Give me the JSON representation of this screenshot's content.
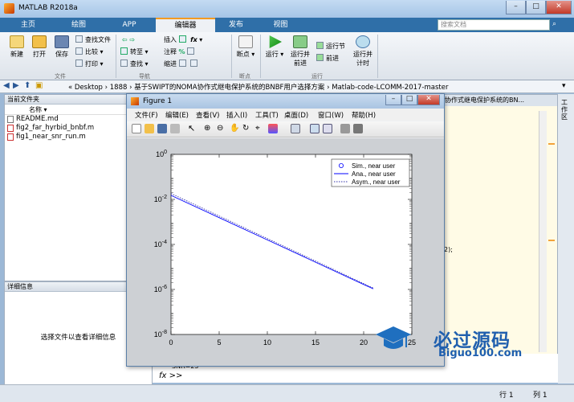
{
  "window": {
    "title": "MATLAB R2018a",
    "min": "–",
    "max": "□",
    "close": "✕"
  },
  "tabs": [
    "主页",
    "绘图",
    "APP",
    "编辑器",
    "发布",
    "视图"
  ],
  "search_placeholder": "搜索文档",
  "ribbon": {
    "file": {
      "new": "新建",
      "open": "打开",
      "save": "保存",
      "find_files": "查找文件",
      "compare": "比较",
      "print": "打印",
      "group": "文件"
    },
    "nav": {
      "insert": "插入",
      "comment": "注释",
      "indent": "缩进",
      "goto": "转至",
      "find": "查找",
      "group": "导航"
    },
    "breakpoints": {
      "label": "断点",
      "group": "断点"
    },
    "run": {
      "run": "运行",
      "run_advance": "运行并\n前进",
      "run_section": "运行节",
      "advance": "前进",
      "run_time": "运行并\n计时",
      "group": "运行"
    }
  },
  "address": {
    "path": "« Desktop › 1888 › 基于SWIPT的NOMA协作式继电保护系统的BNBF用户选择方案 › Matlab-code-LCOMM-2017-master"
  },
  "left_panel": {
    "header": "当前文件夹",
    "col": "名称 ▾",
    "files": [
      {
        "name": "README.md",
        "type": "md"
      },
      {
        "name": "fig2_far_hyrbid_bnbf.m",
        "type": "m"
      },
      {
        "name": "fig1_near_snr_run.m",
        "type": "m"
      }
    ]
  },
  "detail": {
    "header": "详细信息",
    "text": "选择文件以查看详细信息"
  },
  "editor_tab": "协作式继电保护系统的BN...",
  "editor_snippet": "2);",
  "command": {
    "line": "SNR=25",
    "prompt": "fx >>"
  },
  "status": {
    "row": "行 1",
    "col": "列 1"
  },
  "right_strip": "工作区",
  "figure": {
    "title": "Figure 1",
    "menu": [
      "文件(F)",
      "编辑(E)",
      "查看(V)",
      "插入(I)",
      "工具(T)",
      "桌面(D)",
      "窗口(W)",
      "帮助(H)"
    ]
  },
  "chart_data": {
    "type": "line",
    "xlim": [
      0,
      25
    ],
    "ylim": [
      1e-08,
      1
    ],
    "yscale": "log",
    "xticks": [
      "0",
      "5",
      "10",
      "15",
      "20",
      "25"
    ],
    "yticks": [
      "10^0",
      "10^-2",
      "10^-4",
      "10^-6",
      "10^-8"
    ],
    "legend_position": "top-right",
    "series": [
      {
        "name": "Sim., near user",
        "style": "circle",
        "color": "#0000ff",
        "x": [],
        "y": []
      },
      {
        "name": "Ana., near user",
        "style": "solid",
        "color": "#0000ff",
        "x": [
          0,
          5,
          10,
          15,
          20,
          21
        ],
        "y": [
          0.0151,
          0.00155,
          0.000159,
          1.63e-05,
          1.67e-06,
          1.07e-06
        ]
      },
      {
        "name": "Asym., near user",
        "style": "dotted",
        "color": "#3333aa",
        "x": [
          0,
          5,
          10,
          15,
          20,
          21
        ],
        "y": [
          0.0182,
          0.00182,
          0.000182,
          1.82e-05,
          1.82e-06,
          1.16e-06
        ]
      }
    ]
  },
  "watermark": {
    "cn": "必过源码",
    "en": "Biguo100.com"
  }
}
